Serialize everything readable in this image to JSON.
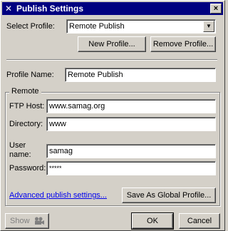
{
  "window": {
    "title": "Publish Settings",
    "close_label": "×"
  },
  "profile": {
    "select_label": "Select Profile:",
    "selected": "Remote Publish",
    "new_button": "New Profile...",
    "remove_button": "Remove Profile...",
    "name_label": "Profile Name:",
    "name_value": "Remote Publish"
  },
  "remote": {
    "group_label": "Remote",
    "ftp_host_label": "FTP Host:",
    "ftp_host_value": "www.samag.org",
    "directory_label": "Directory:",
    "directory_value": "www",
    "user_name_label_1": "User",
    "user_name_label_2": "name:",
    "user_name_value": "samag",
    "password_label": "Password:",
    "password_value": "*****"
  },
  "footer": {
    "advanced_link": "Advanced publish settings...",
    "save_global_button": "Save As Global Profile...",
    "show_button": "Show",
    "ok_button": "OK",
    "cancel_button": "Cancel"
  },
  "colors": {
    "titlebar": "#000080",
    "face": "#d4d0c8",
    "link": "#0000ee"
  },
  "icons": {
    "title": "dreamweaver-icon",
    "show": "film-camera-icon"
  }
}
